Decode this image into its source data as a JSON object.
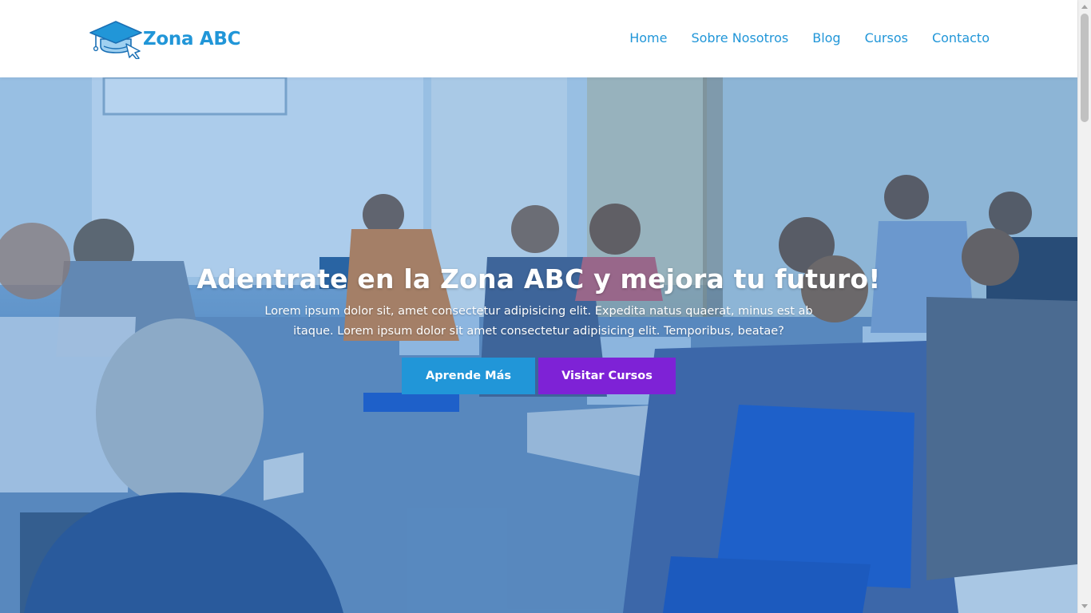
{
  "header": {
    "logo_text": "Zona ABC",
    "logo_icon": "graduation-cap-cursor-icon",
    "nav": [
      {
        "label": "Home"
      },
      {
        "label": "Sobre Nosotros"
      },
      {
        "label": "Blog"
      },
      {
        "label": "Cursos"
      },
      {
        "label": "Contacto"
      }
    ]
  },
  "hero": {
    "title": "Adentrate en la Zona ABC y mejora tu futuro!",
    "text": "Lorem ipsum dolor sit, amet consectetur adipisicing elit. Expedita natus quaerat, minus est ab itaque. Lorem ipsum dolor sit amet consectetur adipisicing elit. Temporibus, beatae?",
    "buttons": {
      "learn_more": "Aprende Más",
      "visit_courses": "Visitar Cursos"
    }
  },
  "colors": {
    "brand_blue": "#2196d8",
    "purple": "#7e22d6",
    "white": "#ffffff"
  }
}
